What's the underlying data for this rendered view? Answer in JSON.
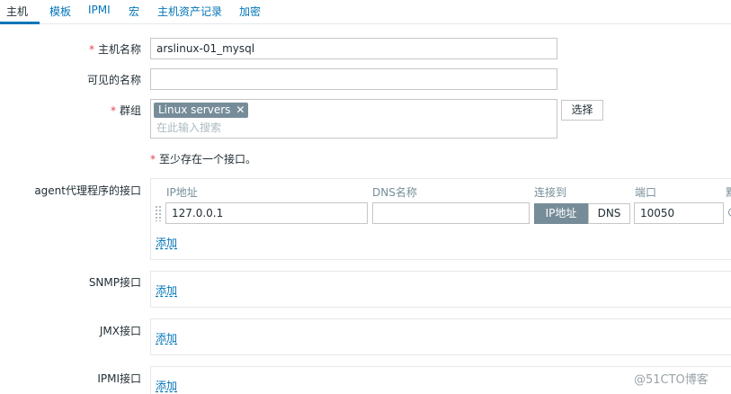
{
  "tabs": [
    {
      "label": "主机"
    },
    {
      "label": "模板"
    },
    {
      "label": "IPMI"
    },
    {
      "label": "宏"
    },
    {
      "label": "主机资产记录"
    },
    {
      "label": "加密"
    }
  ],
  "form": {
    "required_mark": "*",
    "host_name_label": "主机名称",
    "host_name_value": "arslinux-01_mysql",
    "visible_name_label": "可见的名称",
    "visible_name_value": "",
    "groups_label": "群组",
    "group_chip": "Linux servers",
    "group_chip_remove": "✕",
    "group_search_placeholder": "在此输入搜索",
    "select_button": "选择",
    "interface_note": "至少存在一个接口。"
  },
  "interfaces": {
    "agent": {
      "label": "agent代理程序的接口",
      "col_ip": "IP地址",
      "col_dns": "DNS名称",
      "col_connect": "连接到",
      "col_port": "端口",
      "col_default": "默",
      "ip_value": "127.0.0.1",
      "dns_value": "",
      "connect_ip": "IP地址",
      "connect_dns": "DNS",
      "port_value": "10050",
      "add_link": "添加"
    },
    "snmp": {
      "label": "SNMP接口",
      "add_link": "添加"
    },
    "jmx": {
      "label": "JMX接口",
      "add_link": "添加"
    },
    "ipmi": {
      "label": "IPMI接口",
      "add_link": "添加"
    }
  },
  "watermark": "@51CTO博客",
  "colors": {
    "link": "#0275b8",
    "required": "#e54251",
    "chip": "#768d99",
    "border": "#c6c6c6"
  }
}
